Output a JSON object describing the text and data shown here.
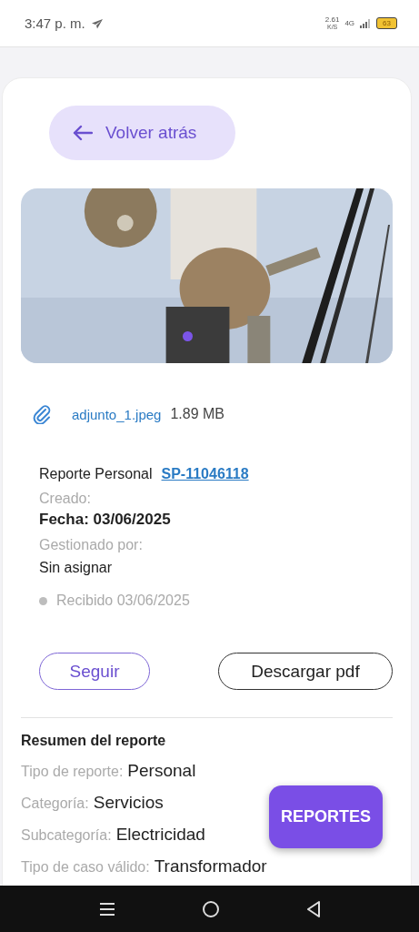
{
  "status_bar": {
    "time": "3:47 p. m.",
    "speed": "2.61",
    "speed_unit": "K/S",
    "network": "4G",
    "battery": "63"
  },
  "back_button": {
    "label": "Volver atrás"
  },
  "attachment": {
    "name": "adjunto_1.jpeg",
    "size": "1.89 MB"
  },
  "report": {
    "title": "Reporte Personal",
    "code": "SP-11046118",
    "created_label": "Creado:",
    "date": "Fecha: 03/06/2025",
    "managed_label": "Gestionado por:",
    "managed_value": "Sin asignar",
    "status": "Recibido 03/06/2025"
  },
  "actions": [
    {
      "label": "Seguir",
      "kind": "primary"
    },
    {
      "label": "Descargar pdf",
      "kind": "secondary"
    }
  ],
  "summary": {
    "title": "Resumen del reporte",
    "rows": [
      {
        "label": "Tipo de reporte:",
        "value": "Personal"
      },
      {
        "label": "Categoría:",
        "value": "Servicios"
      },
      {
        "label": "Subcategoría:",
        "value": "Electricidad"
      },
      {
        "label": "Tipo de caso válido:",
        "value": "Transformador"
      }
    ]
  },
  "fab": {
    "label": "REPORTES"
  }
}
